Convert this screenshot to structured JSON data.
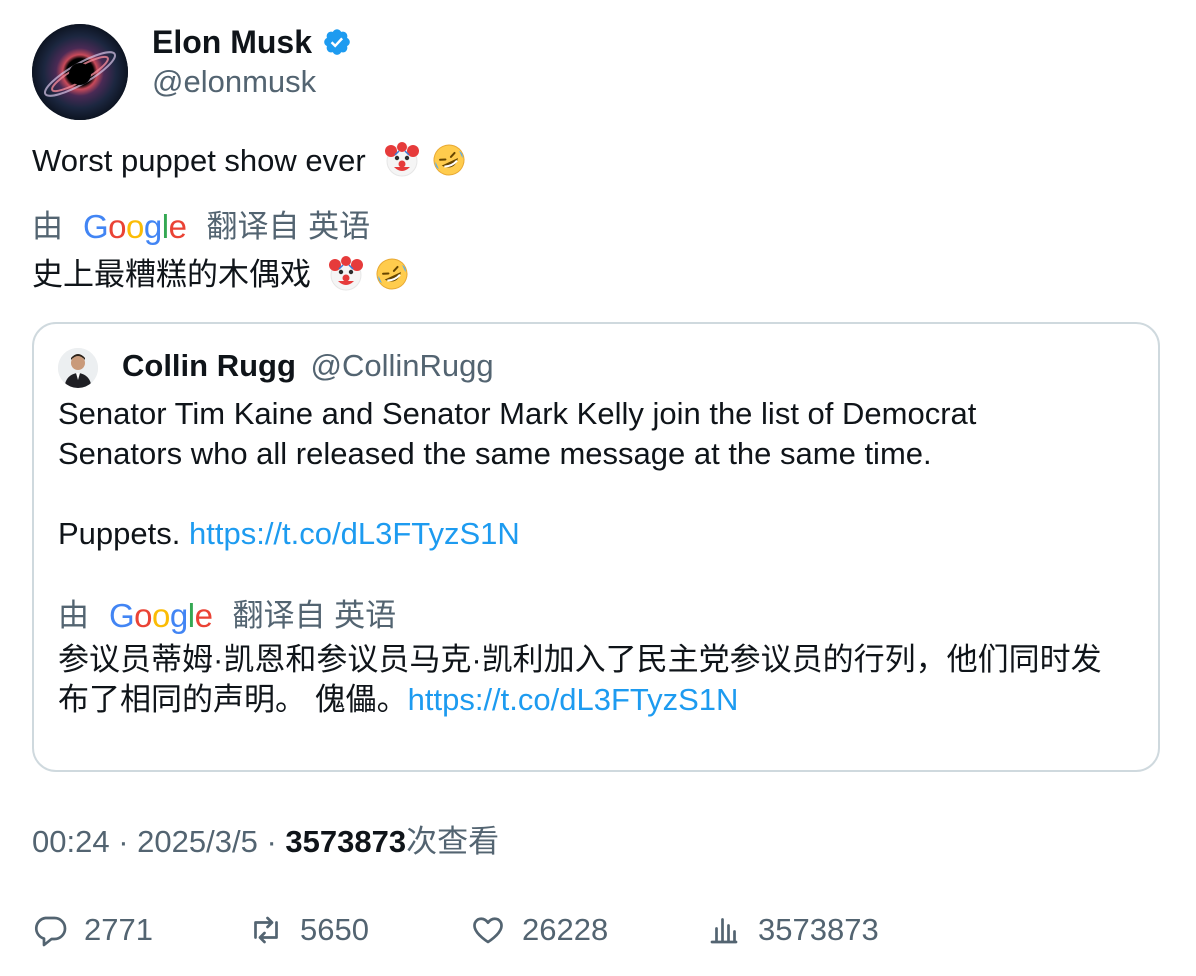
{
  "author": {
    "display_name": "Elon Musk",
    "handle": "@elonmusk",
    "verified": true
  },
  "tweet": {
    "text": "Worst puppet show ever",
    "emojis": [
      "clown-face",
      "rolling-on-floor-laughing"
    ]
  },
  "translation": {
    "prefix": "由",
    "provider": "Google",
    "suffix": "翻译自 英语",
    "text": "史上最糟糕的木偶戏"
  },
  "quote": {
    "display_name": "Collin Rugg",
    "handle": "@CollinRugg",
    "line1": "Senator Tim Kaine and Senator Mark Kelly join the list of Democrat",
    "line2": "Senators who all released the same message at the same time.",
    "puppets_prefix": "Puppets.",
    "link": "https://t.co/dL3FTyzS1N",
    "translation": {
      "prefix": "由",
      "provider": "Google",
      "suffix": "翻译自 英语",
      "line1": "参议员蒂姆·凯恩和参议员马克·凯利加入了民主党参议员的行列，他们同时发",
      "line2": "布了相同的声明。 傀儡。",
      "link": "https://t.co/dL3FTyzS1N"
    }
  },
  "meta": {
    "time": "00:24",
    "separator": "·",
    "date": "2025/3/5",
    "views": "3573873",
    "views_suffix": "次查看"
  },
  "actions": {
    "replies": "2771",
    "retweets": "5650",
    "likes": "26228",
    "views": "3573873"
  },
  "colors": {
    "text": "#0f1419",
    "secondary": "#536471",
    "link": "#1d9bf0",
    "border": "#cfd9de",
    "verified": "#1d9bf0"
  }
}
